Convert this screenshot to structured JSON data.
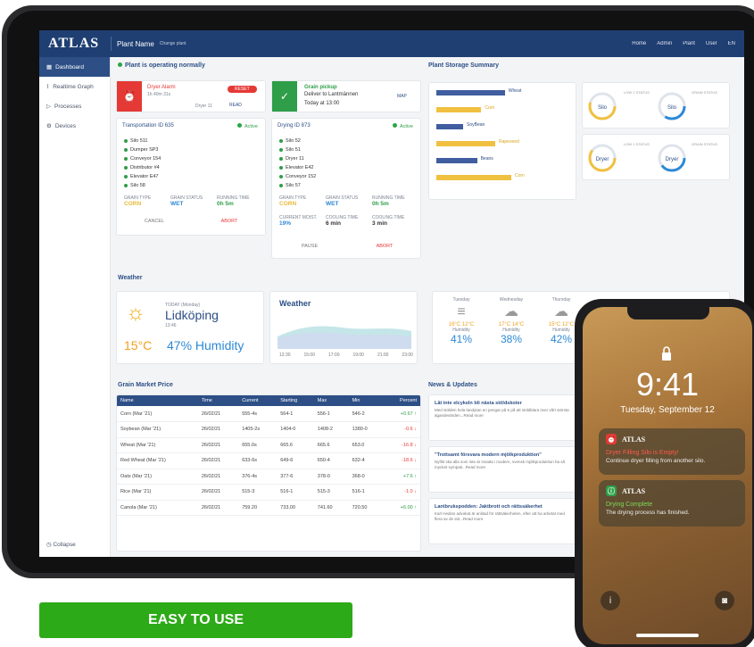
{
  "app": {
    "brand": "ATLAS",
    "plant_name": "Plant Name",
    "plant_change": "Change plant",
    "nav": [
      "Home",
      "Admin",
      "Plant",
      "User",
      "EN"
    ]
  },
  "sidebar": {
    "items": [
      {
        "label": "Dashboard"
      },
      {
        "label": "Realtime Graph"
      },
      {
        "label": "Processes"
      },
      {
        "label": "Devices"
      }
    ],
    "collapse": "Collapse"
  },
  "status": {
    "text": "Plant is operating normally"
  },
  "alarm": {
    "title": "Dryer Alarm",
    "ago": "1h 40m 31s",
    "button": "RESET",
    "device": "Dryer 11",
    "read": "READ"
  },
  "pickup": {
    "title": "Grain pickup",
    "subtitle": "Deliver to Lantmännen",
    "when": "Today at 13:00",
    "map": "MAP"
  },
  "transport": {
    "title": "Transportation ID 635",
    "state": "Active",
    "rows": [
      "Silo 511",
      "Dumper SP3",
      "Conveyor 154",
      "Distributor #4",
      "Elevator E47",
      "Silo 58"
    ],
    "kpi": [
      {
        "label": "GRAIN TYPE",
        "value": "CORN"
      },
      {
        "label": "GRAIN STATUS",
        "value": "WET"
      },
      {
        "label": "RUNNING TIME",
        "value": "0h 5m"
      }
    ],
    "cancel": "CANCEL",
    "abort": "ABORT"
  },
  "drying": {
    "title": "Drying ID 873",
    "state": "Active",
    "rows": [
      "Silo 52",
      "Silo 51",
      "Dryer 11",
      "Elevator E42",
      "Conveyor 152",
      "Silo 57"
    ],
    "kpi": [
      {
        "label": "GRAIN TYPE",
        "value": "CORN"
      },
      {
        "label": "GRAIN STATUS",
        "value": "WET"
      },
      {
        "label": "RUNNING TIME",
        "value": "0h 5m"
      },
      {
        "label": "CURRENT MOIST.",
        "value": "19%"
      },
      {
        "label": "COOLING TIME",
        "value": "6 min"
      },
      {
        "label": "COOLING TIME",
        "value": "3 min"
      }
    ],
    "pause": "PAUSE",
    "abort": "ABORT"
  },
  "storage": {
    "title": "Plant Storage Summary",
    "bars": [
      {
        "label": "Wheat",
        "blue": 0.64,
        "yellow": 0.0
      },
      {
        "label": "Corn",
        "blue": 0.0,
        "yellow": 0.42
      },
      {
        "label": "SoyBean",
        "blue": 0.25,
        "yellow": 0.0
      },
      {
        "label": "Rapeseed",
        "blue": 0.0,
        "yellow": 0.55
      },
      {
        "label": "Beans",
        "blue": 0.38,
        "yellow": 0.0
      },
      {
        "label": "Corn",
        "blue": 0.0,
        "yellow": 0.7
      }
    ],
    "gauges": [
      {
        "name": "Silo",
        "left": "LOW 1 STATUS",
        "right": "GRAIN STATUS",
        "fill": 0.55
      },
      {
        "name": "Silo",
        "left": "",
        "right": "",
        "fill": 0.35
      },
      {
        "name": "Dryer",
        "left": "LOW 1 STATUS",
        "right": "GRAIN STATUS",
        "fill": 0.6
      },
      {
        "name": "Dryer",
        "left": "",
        "right": "",
        "fill": 0.4
      }
    ]
  },
  "weather": {
    "title": "Weather",
    "today": {
      "label": "TODAY (Monday)",
      "city": "Lidköping",
      "time": "13:46",
      "temp": "15°C",
      "humidity": "47% Humidity"
    },
    "graph_title": "Weather",
    "graph_times": [
      "12:30",
      "15:00",
      "17:00",
      "19:00",
      "21:00",
      "23:00"
    ],
    "days": [
      {
        "day": "Tuesday",
        "temps": "16°C 12°C",
        "hum_label": "Humidity",
        "hum": "41%"
      },
      {
        "day": "Wednesday",
        "temps": "17°C 14°C",
        "hum_label": "Humidity",
        "hum": "38%"
      },
      {
        "day": "Thursday",
        "temps": "15°C 12°C",
        "hum_label": "Humidity",
        "hum": "42%"
      }
    ]
  },
  "market": {
    "title": "Grain Market Price",
    "headers": [
      "Name",
      "Time",
      "Current",
      "Starting",
      "Max",
      "Min",
      "Percent"
    ],
    "rows": [
      [
        "Corn (Mar '21)",
        "26/02/21",
        "555-4s",
        "564-1",
        "556-1",
        "546-2",
        "+0.67 ↑"
      ],
      [
        "Soybean (Mar '21)",
        "26/02/21",
        "1405-2s",
        "1404-0",
        "1408-2",
        "1380-0",
        "-0.6 ↓"
      ],
      [
        "Wheat (Mar '21)",
        "26/02/21",
        "655.0s",
        "665.6",
        "665.6",
        "653.0",
        "-16.8 ↓"
      ],
      [
        "Red Wheat (Mar '21)",
        "26/02/21",
        "633-6s",
        "649-6",
        "650-4",
        "632-4",
        "-18.6 ↓"
      ],
      [
        "Oats (Mar '21)",
        "26/02/21",
        "376-4s",
        "377-6",
        "378-0",
        "368-0",
        "+7.6 ↑"
      ],
      [
        "Rice (Mar '21)",
        "26/02/21",
        "515-3",
        "516-1",
        "515-3",
        "516-1",
        "-1.0 ↓"
      ],
      [
        "Canola (Mar '21)",
        "26/02/21",
        "759.20",
        "733.00",
        "741.60",
        "720.50",
        "+6.00 ↑"
      ]
    ],
    "signs": [
      "pos",
      "neg",
      "neg",
      "neg",
      "pos",
      "neg",
      "pos"
    ]
  },
  "news": {
    "title": "News & Updates",
    "items": [
      {
        "title": "Låt inte elcykeln bli nästa stöldskoter",
        "body": "Med stölden hela landytan en pengar på 6 på att stöldklara över vårt största ägandevärden...Read more"
      },
      {
        "title": "\"Trottsamt försvara modern mjölkproduktion\"",
        "body": "Nyfikt ska alla som inte är insatta i modern, svensk mjölkproduktion ha så mycket sympati...Read more"
      },
      {
        "title": "Lantbrukspodden: Jaktbrott och rättssäkerhet",
        "body": "Karl Hedins advokat är anlitad för rättsäkerheten, efter att ha arbetat med flera av de stö...Read more"
      }
    ]
  },
  "phone": {
    "time": "9:41",
    "date": "Tuesday, September 12",
    "notifications": [
      {
        "app": "ATLAS",
        "title": "Dryer Filling Silo is Empty!",
        "body": "Continue dryer filling from another silo.",
        "color": "#e53935"
      },
      {
        "app": "ATLAS",
        "title": "Drying Complete",
        "body": "The drying process has finished.",
        "color": "#2e9e48"
      }
    ]
  },
  "cta": {
    "label": "EASY TO USE"
  },
  "colors": {
    "navy": "#1f3f73",
    "blue": "#2d4f86",
    "green": "#2daa17",
    "red": "#e53935",
    "yellow": "#f0c040"
  }
}
